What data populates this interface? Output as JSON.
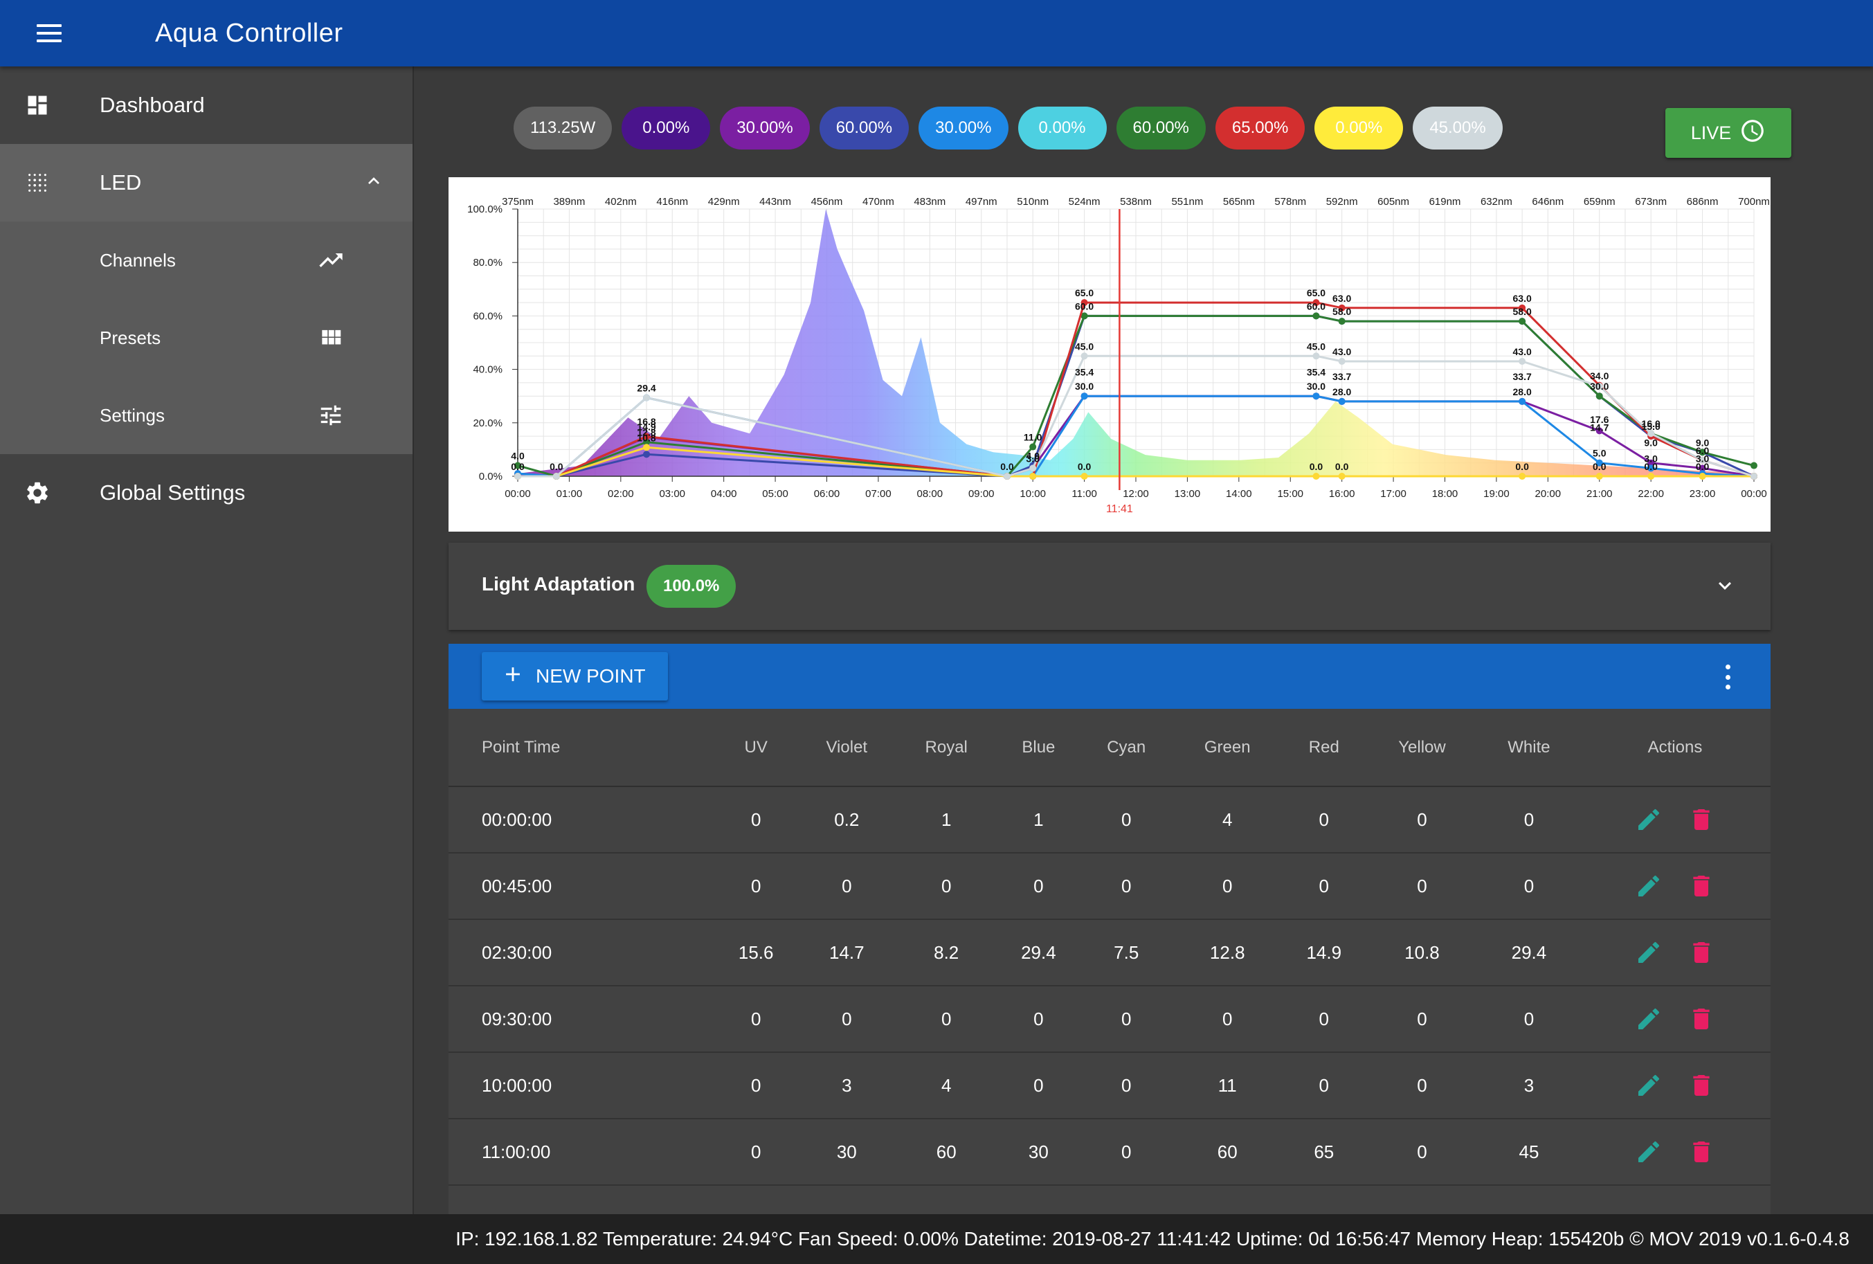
{
  "app": {
    "title": "Aqua Controller"
  },
  "sidebar": {
    "dashboard": "Dashboard",
    "led": "LED",
    "channels": "Channels",
    "presets": "Presets",
    "settings": "Settings",
    "global_settings": "Global Settings"
  },
  "pills": [
    {
      "label": "113.25W",
      "color": "#616161",
      "text": "#ffffff"
    },
    {
      "label": "0.00%",
      "color": "#4a148c",
      "text": "#ffffff"
    },
    {
      "label": "30.00%",
      "color": "#7b1fa2",
      "text": "#ffffff"
    },
    {
      "label": "60.00%",
      "color": "#3949ab",
      "text": "#ffffff"
    },
    {
      "label": "30.00%",
      "color": "#1e88e5",
      "text": "#ffffff"
    },
    {
      "label": "0.00%",
      "color": "#4dd0e1",
      "text": "#ffffff"
    },
    {
      "label": "60.00%",
      "color": "#2e7d32",
      "text": "#ffffff"
    },
    {
      "label": "65.00%",
      "color": "#d32f2f",
      "text": "#ffffff"
    },
    {
      "label": "0.00%",
      "color": "#ffeb3b",
      "text": "#ffffff"
    },
    {
      "label": "45.00%",
      "color": "#cfd8dc",
      "text": "#ffffff"
    }
  ],
  "live_button": "LIVE",
  "light_adaptation": {
    "title": "Light Adaptation",
    "value": "100.0%"
  },
  "toolbar": {
    "new_point": "NEW POINT"
  },
  "table": {
    "headers": [
      "Point Time",
      "UV",
      "Violet",
      "Royal",
      "Blue",
      "Cyan",
      "Green",
      "Red",
      "Yellow",
      "White",
      "Actions"
    ],
    "rows": [
      [
        "00:00:00",
        "0",
        "0.2",
        "1",
        "1",
        "0",
        "4",
        "0",
        "0",
        "0"
      ],
      [
        "00:45:00",
        "0",
        "0",
        "0",
        "0",
        "0",
        "0",
        "0",
        "0",
        "0"
      ],
      [
        "02:30:00",
        "15.6",
        "14.7",
        "8.2",
        "29.4",
        "7.5",
        "12.8",
        "14.9",
        "10.8",
        "29.4"
      ],
      [
        "09:30:00",
        "0",
        "0",
        "0",
        "0",
        "0",
        "0",
        "0",
        "0",
        "0"
      ],
      [
        "10:00:00",
        "0",
        "3",
        "4",
        "0",
        "0",
        "11",
        "0",
        "0",
        "3"
      ],
      [
        "11:00:00",
        "0",
        "30",
        "60",
        "30",
        "0",
        "60",
        "65",
        "0",
        "45"
      ]
    ]
  },
  "footer": "IP: 192.168.1.82 Temperature: 24.94°C Fan Speed: 0.00% Datetime: 2019-08-27 11:41:42 Uptime: 0d 16:56:47 Memory Heap: 155420b © MOV 2019 v0.1.6-0.4.8",
  "chart_data": {
    "type": "line",
    "top_axis_labels": [
      "375nm",
      "389nm",
      "402nm",
      "416nm",
      "429nm",
      "443nm",
      "456nm",
      "470nm",
      "483nm",
      "497nm",
      "510nm",
      "524nm",
      "538nm",
      "551nm",
      "565nm",
      "578nm",
      "592nm",
      "605nm",
      "619nm",
      "632nm",
      "646nm",
      "659nm",
      "673nm",
      "686nm",
      "700nm"
    ],
    "x_ticks": [
      "00:00",
      "01:00",
      "02:00",
      "03:00",
      "04:00",
      "05:00",
      "06:00",
      "07:00",
      "08:00",
      "09:00",
      "10:00",
      "11:00",
      "12:00",
      "13:00",
      "14:00",
      "15:00",
      "16:00",
      "17:00",
      "18:00",
      "19:00",
      "20:00",
      "21:00",
      "22:00",
      "23:00",
      "00:00"
    ],
    "y_ticks": [
      "0.0%",
      "20.0%",
      "40.0%",
      "60.0%",
      "80.0%",
      "100.0%"
    ],
    "ylim": [
      0,
      100
    ],
    "xlim_hours": [
      0,
      24
    ],
    "current_time": "11:41",
    "current_time_hours": 11.683,
    "grid": true,
    "spectrum": [
      [
        375,
        1
      ],
      [
        392,
        4
      ],
      [
        404,
        22
      ],
      [
        412,
        14
      ],
      [
        420,
        30
      ],
      [
        426,
        20
      ],
      [
        436,
        16
      ],
      [
        445,
        38
      ],
      [
        452,
        65
      ],
      [
        456,
        100
      ],
      [
        459,
        85
      ],
      [
        462,
        75
      ],
      [
        466,
        62
      ],
      [
        471,
        36
      ],
      [
        476,
        30
      ],
      [
        481,
        52
      ],
      [
        486,
        20
      ],
      [
        493,
        12
      ],
      [
        500,
        9
      ],
      [
        507,
        8
      ],
      [
        515,
        6
      ],
      [
        521,
        14
      ],
      [
        525,
        24
      ],
      [
        531,
        14
      ],
      [
        540,
        8
      ],
      [
        551,
        6
      ],
      [
        565,
        6
      ],
      [
        575,
        7
      ],
      [
        583,
        16
      ],
      [
        590,
        28
      ],
      [
        596,
        22
      ],
      [
        605,
        12
      ],
      [
        619,
        8
      ],
      [
        632,
        6
      ],
      [
        646,
        5
      ],
      [
        659,
        4
      ],
      [
        673,
        3
      ],
      [
        686,
        2
      ],
      [
        700,
        1
      ]
    ],
    "series": [
      {
        "name": "Violet",
        "color": "#7b1fa2",
        "x": [
          0,
          0.75,
          2.5,
          9.5,
          10,
          11,
          15.5,
          16,
          19.5,
          21,
          22,
          23,
          24
        ],
        "y": [
          0.2,
          0,
          14.7,
          0,
          3,
          30,
          30,
          28,
          28,
          17,
          5,
          3,
          0
        ]
      },
      {
        "name": "Royal",
        "color": "#3949ab",
        "x": [
          0,
          0.75,
          2.5,
          9.5,
          10,
          11,
          15.5,
          16,
          19.5,
          21,
          22,
          23,
          24
        ],
        "y": [
          1,
          0,
          8.2,
          0,
          4,
          60,
          60,
          58,
          58,
          30,
          15,
          9,
          0
        ]
      },
      {
        "name": "Blue",
        "color": "#1e88e5",
        "x": [
          0,
          0.75,
          2.5,
          9.5,
          10,
          11,
          15.5,
          16,
          19.5,
          21,
          22,
          23,
          24
        ],
        "y": [
          1,
          0,
          29.4,
          0,
          0,
          30,
          30,
          28,
          28,
          5,
          3,
          1,
          0
        ]
      },
      {
        "name": "Green",
        "color": "#2e7d32",
        "x": [
          0,
          0.75,
          2.5,
          9.5,
          10,
          11,
          15.5,
          16,
          19.5,
          21,
          22,
          23,
          24
        ],
        "y": [
          4,
          0,
          12.8,
          0,
          11,
          60,
          60,
          58,
          58,
          30,
          16,
          9,
          4
        ]
      },
      {
        "name": "Red",
        "color": "#d32f2f",
        "x": [
          0,
          0.75,
          2.5,
          9.5,
          10,
          11,
          15.5,
          16,
          19.5,
          21,
          22,
          23,
          24
        ],
        "y": [
          0,
          0,
          14.9,
          0,
          0,
          65,
          65,
          63,
          63,
          34,
          15,
          6,
          0
        ]
      },
      {
        "name": "Yellow",
        "color": "#fdd835",
        "x": [
          0,
          0.75,
          2.5,
          9.5,
          10,
          11,
          15.5,
          16,
          19.5,
          21,
          22,
          23,
          24
        ],
        "y": [
          0,
          0,
          10.8,
          0,
          0,
          0,
          0,
          0,
          0,
          0,
          0,
          0,
          0
        ]
      },
      {
        "name": "White",
        "color": "#cfd8dc",
        "x": [
          0,
          0.75,
          2.5,
          9.5,
          10,
          11,
          15.5,
          16,
          19.5,
          21,
          22,
          23,
          24
        ],
        "y": [
          0,
          0,
          29.4,
          0,
          3,
          45,
          45,
          43,
          43,
          33.7,
          16,
          6,
          0
        ]
      }
    ],
    "point_labels": [
      {
        "t": 0,
        "v": 4.0,
        "text": "4.0"
      },
      {
        "t": 0,
        "v": 0,
        "text": "0.0"
      },
      {
        "t": 0.75,
        "v": 0,
        "text": "0.0"
      },
      {
        "t": 2.5,
        "v": 29.4,
        "text": "29.4"
      },
      {
        "t": 2.5,
        "v": 16.8,
        "text": "16.8"
      },
      {
        "t": 2.5,
        "v": 14.9,
        "text": "14.9"
      },
      {
        "t": 2.5,
        "v": 12.8,
        "text": "12.8"
      },
      {
        "t": 2.5,
        "v": 10.8,
        "text": "10.8"
      },
      {
        "t": 9.5,
        "v": 0,
        "text": "0.0"
      },
      {
        "t": 10,
        "v": 11,
        "text": "11.0"
      },
      {
        "t": 10,
        "v": 4,
        "text": "4.0"
      },
      {
        "t": 10,
        "v": 3,
        "text": "3.0"
      },
      {
        "t": 11,
        "v": 65,
        "text": "65.0"
      },
      {
        "t": 11,
        "v": 60,
        "text": "60.0"
      },
      {
        "t": 11,
        "v": 45,
        "text": "45.0"
      },
      {
        "t": 11,
        "v": 35.4,
        "text": "35.4"
      },
      {
        "t": 11,
        "v": 30,
        "text": "30.0"
      },
      {
        "t": 11,
        "v": 0,
        "text": "0.0"
      },
      {
        "t": 15.5,
        "v": 65,
        "text": "65.0"
      },
      {
        "t": 15.5,
        "v": 60,
        "text": "60.0"
      },
      {
        "t": 15.5,
        "v": 45,
        "text": "45.0"
      },
      {
        "t": 15.5,
        "v": 35.4,
        "text": "35.4"
      },
      {
        "t": 15.5,
        "v": 30,
        "text": "30.0"
      },
      {
        "t": 15.5,
        "v": 0,
        "text": "0.0"
      },
      {
        "t": 16,
        "v": 63,
        "text": "63.0"
      },
      {
        "t": 16,
        "v": 58,
        "text": "58.0"
      },
      {
        "t": 16,
        "v": 43,
        "text": "43.0"
      },
      {
        "t": 16,
        "v": 33.7,
        "text": "33.7"
      },
      {
        "t": 16,
        "v": 28,
        "text": "28.0"
      },
      {
        "t": 16,
        "v": 0,
        "text": "0.0"
      },
      {
        "t": 19.5,
        "v": 63,
        "text": "63.0"
      },
      {
        "t": 19.5,
        "v": 58,
        "text": "58.0"
      },
      {
        "t": 19.5,
        "v": 43,
        "text": "43.0"
      },
      {
        "t": 19.5,
        "v": 33.7,
        "text": "33.7"
      },
      {
        "t": 19.5,
        "v": 28,
        "text": "28.0"
      },
      {
        "t": 19.5,
        "v": 0,
        "text": "0.0"
      },
      {
        "t": 21,
        "v": 34,
        "text": "34.0"
      },
      {
        "t": 21,
        "v": 30,
        "text": "30.0"
      },
      {
        "t": 21,
        "v": 17.6,
        "text": "17.6"
      },
      {
        "t": 21,
        "v": 14.7,
        "text": "14.7"
      },
      {
        "t": 21,
        "v": 5,
        "text": "5.0"
      },
      {
        "t": 21,
        "v": 0,
        "text": "0.0"
      },
      {
        "t": 22,
        "v": 16,
        "text": "16.0"
      },
      {
        "t": 22,
        "v": 15,
        "text": "15.0"
      },
      {
        "t": 22,
        "v": 9,
        "text": "9.0"
      },
      {
        "t": 22,
        "v": 3,
        "text": "3.0"
      },
      {
        "t": 22,
        "v": 0,
        "text": "0.0"
      },
      {
        "t": 23,
        "v": 9,
        "text": "9.0"
      },
      {
        "t": 23,
        "v": 6,
        "text": "6.0"
      },
      {
        "t": 23,
        "v": 3,
        "text": "3.0"
      },
      {
        "t": 23,
        "v": 0,
        "text": "0.0"
      }
    ]
  }
}
